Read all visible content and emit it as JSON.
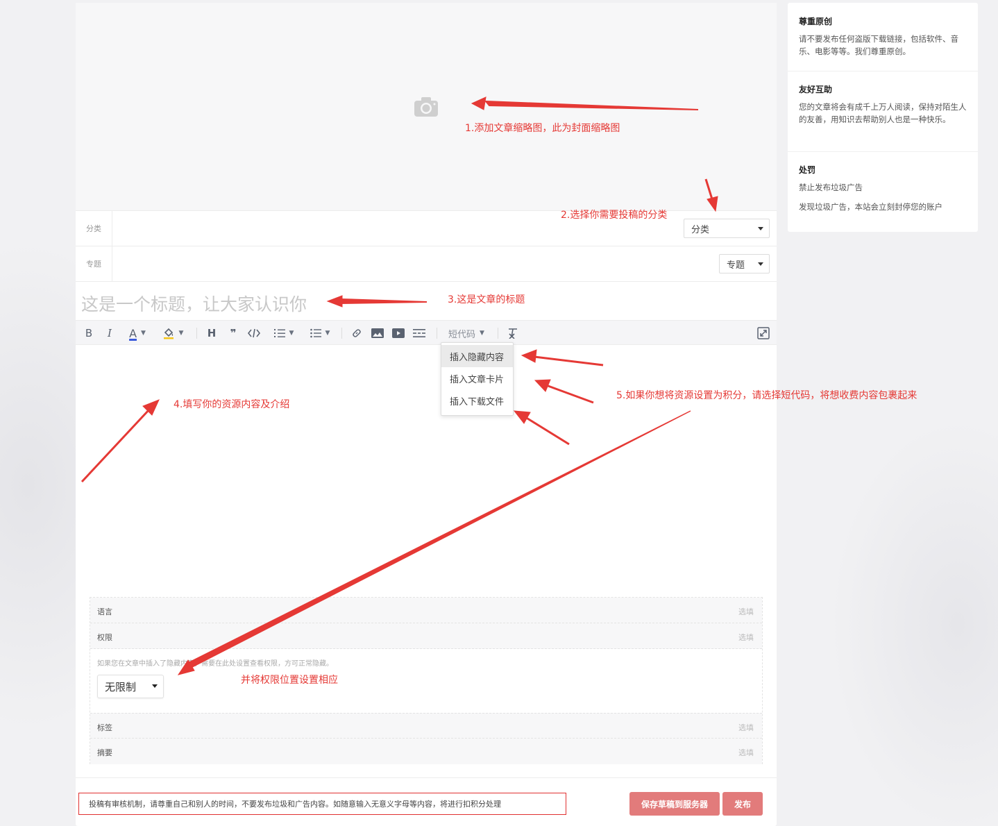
{
  "form": {
    "category_label": "分类",
    "category_select": "分类",
    "topic_label": "专题",
    "topic_select": "专题",
    "title_placeholder": "这是一个标题，让大家认识你",
    "toolbar": {
      "bold": "B",
      "italic": "I",
      "font_color": "A",
      "heading": "H",
      "quote": "❞",
      "shortcode": "短代码"
    },
    "shortcode_menu": [
      "插入隐藏内容",
      "插入文章卡片",
      "插入下载文件"
    ],
    "meta": {
      "language_label": "语言",
      "permission_label": "权限",
      "optional": "选填",
      "permission_hint": "如果您在文章中插入了隐藏内容，需要在此处设置查看权限，方可正常隐藏。",
      "permission_value": "无限制",
      "tags_label": "标签",
      "summary_label": "摘要"
    },
    "notice": "投稿有审核机制，请尊重自己和别人的时间，不要发布垃圾和广告内容。如随意输入无意义字母等内容，将进行扣积分处理",
    "save_draft_button": "保存草稿到服务器",
    "publish_button": "发布"
  },
  "sidebar": {
    "sections": [
      {
        "title": "尊重原创",
        "lines": [
          "请不要发布任何盗版下载链接，包括软件、音乐、电影等等。我们尊重原创。"
        ]
      },
      {
        "title": "友好互助",
        "lines": [
          "您的文章将会有成千上万人阅读，保持对陌生人的友善，用知识去帮助别人也是一种快乐。"
        ]
      },
      {
        "title": "处罚",
        "lines": [
          "禁止发布垃圾广告",
          "发现垃圾广告，本站会立刻封停您的账户"
        ]
      }
    ]
  },
  "annotations": {
    "a1": "1.添加文章缩略图，此为封面缩略图",
    "a2": "2.选择你需要投稿的分类",
    "a3": "3.这是文章的标题",
    "a4": "4.填写你的资源内容及介绍",
    "a5": "5.如果你想将资源设置为积分，请选择短代码，将想收费内容包裹起来",
    "a6": "并将权限位置设置相应"
  },
  "colors": {
    "annotation_red": "#e53935",
    "button_red": "#e27b7b",
    "toolbar_bg": "#f5f5f7"
  }
}
